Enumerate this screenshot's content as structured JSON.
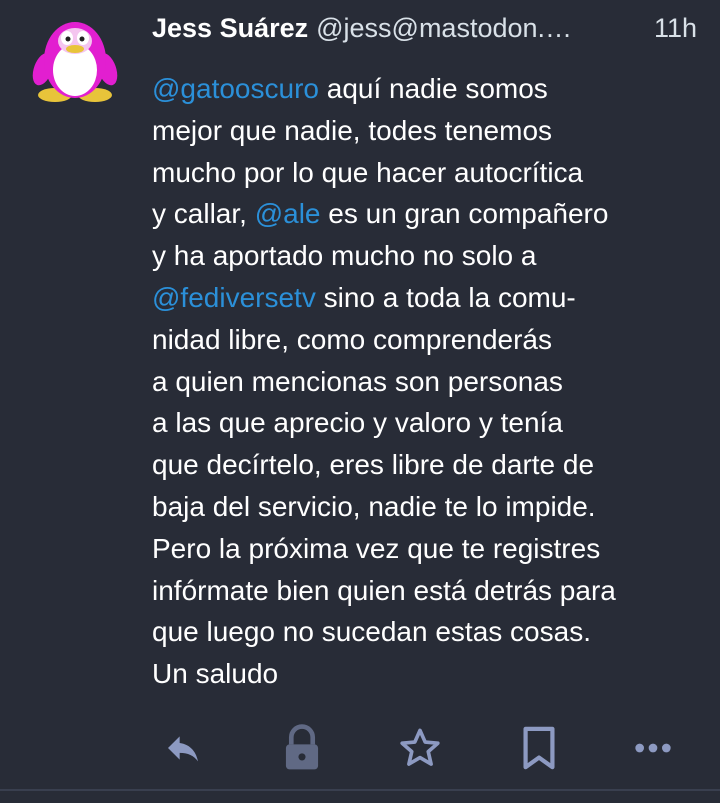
{
  "status": {
    "display_name": "Jess Suárez",
    "acct": "@jess@mastodon.…",
    "time": "11h",
    "content": [
      [
        {
          "mention": "@gatooscuro"
        },
        {
          "text": " aquí nadie somos"
        }
      ],
      [
        {
          "text": "mejor que nadie, todes tenemos"
        }
      ],
      [
        {
          "text": "mucho por lo que hacer autocrítica"
        }
      ],
      [
        {
          "text": "y callar, "
        },
        {
          "mention": "@ale"
        },
        {
          "text": " es un gran compañero"
        }
      ],
      [
        {
          "text": "y ha aportado mucho no solo a"
        }
      ],
      [
        {
          "mention": "@fediversetv"
        },
        {
          "text": " sino a toda la comu-"
        }
      ],
      [
        {
          "text": "nidad libre, como comprenderás"
        }
      ],
      [
        {
          "text": "a quien mencionas son personas"
        }
      ],
      [
        {
          "text": "a las que aprecio y valoro y tenía"
        }
      ],
      [
        {
          "text": "que decírtelo, eres libre de darte de"
        }
      ],
      [
        {
          "text": "baja del servicio, nadie te lo impide."
        }
      ],
      [
        {
          "text": "Pero la próxima vez que te registres"
        }
      ],
      [
        {
          "text": "infórmate bien quien está detrás para"
        }
      ],
      [
        {
          "text": "que luego no sucedan estas cosas."
        }
      ],
      [
        {
          "text": "Un saludo"
        }
      ]
    ]
  },
  "actions": [
    {
      "name": "reply-icon",
      "label": "reply"
    },
    {
      "name": "lock-icon",
      "label": "locked"
    },
    {
      "name": "star-icon",
      "label": "favourite"
    },
    {
      "name": "bookmark-icon",
      "label": "bookmark"
    },
    {
      "name": "more-icon",
      "label": "more"
    }
  ],
  "colors": {
    "background": "#282c37",
    "mention": "#2b90d9",
    "icon": "#8d9ac2",
    "lock_icon": "#606984",
    "avatar_accent": "#e21fd0"
  }
}
